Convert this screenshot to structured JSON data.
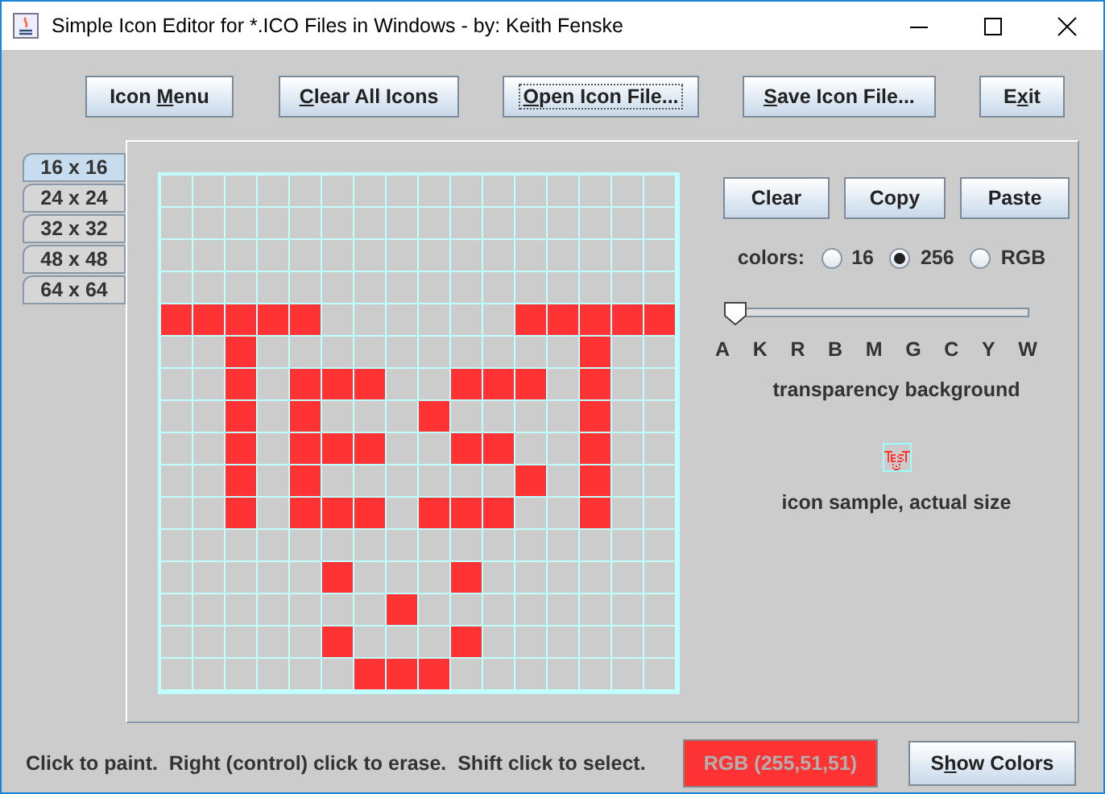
{
  "window": {
    "title": "Simple Icon Editor for *.ICO Files in Windows - by: Keith Fenske"
  },
  "toolbar": [
    {
      "before": "Icon ",
      "key": "M",
      "after": "enu",
      "focused": false
    },
    {
      "key": "C",
      "after": "lear All Icons",
      "focused": false
    },
    {
      "key": "O",
      "after": "pen Icon File...",
      "focused": true
    },
    {
      "key": "S",
      "after": "ave Icon File...",
      "focused": false
    },
    {
      "before": "E",
      "key": "x",
      "after": "it",
      "focused": false
    }
  ],
  "size_tabs": [
    {
      "label": "16 x 16",
      "selected": true
    },
    {
      "label": "24 x 24",
      "selected": false
    },
    {
      "label": "32 x 32",
      "selected": false
    },
    {
      "label": "48 x 48",
      "selected": false
    },
    {
      "label": "64 x 64",
      "selected": false
    }
  ],
  "canvas": {
    "rows": [
      [
        false,
        false,
        false,
        false,
        false,
        false,
        false,
        false,
        false,
        false,
        false,
        false,
        false,
        false,
        false,
        false
      ],
      [
        false,
        false,
        false,
        false,
        false,
        false,
        false,
        false,
        false,
        false,
        false,
        false,
        false,
        false,
        false,
        false
      ],
      [
        false,
        false,
        false,
        false,
        false,
        false,
        false,
        false,
        false,
        false,
        false,
        false,
        false,
        false,
        false,
        false
      ],
      [
        false,
        false,
        false,
        false,
        false,
        false,
        false,
        false,
        false,
        false,
        false,
        false,
        false,
        false,
        false,
        false
      ],
      [
        true,
        true,
        true,
        true,
        true,
        false,
        false,
        false,
        false,
        false,
        false,
        true,
        true,
        true,
        true,
        true
      ],
      [
        false,
        false,
        true,
        false,
        false,
        false,
        false,
        false,
        false,
        false,
        false,
        false,
        false,
        true,
        false,
        false
      ],
      [
        false,
        false,
        true,
        false,
        true,
        true,
        true,
        false,
        false,
        true,
        true,
        true,
        false,
        true,
        false,
        false
      ],
      [
        false,
        false,
        true,
        false,
        true,
        false,
        false,
        false,
        true,
        false,
        false,
        false,
        false,
        true,
        false,
        false
      ],
      [
        false,
        false,
        true,
        false,
        true,
        true,
        true,
        false,
        false,
        true,
        true,
        false,
        false,
        true,
        false,
        false
      ],
      [
        false,
        false,
        true,
        false,
        true,
        false,
        false,
        false,
        false,
        false,
        false,
        true,
        false,
        true,
        false,
        false
      ],
      [
        false,
        false,
        true,
        false,
        true,
        true,
        true,
        false,
        true,
        true,
        true,
        false,
        false,
        true,
        false,
        false
      ],
      [
        false,
        false,
        false,
        false,
        false,
        false,
        false,
        false,
        false,
        false,
        false,
        false,
        false,
        false,
        false,
        false
      ],
      [
        false,
        false,
        false,
        false,
        false,
        true,
        false,
        false,
        false,
        true,
        false,
        false,
        false,
        false,
        false,
        false
      ],
      [
        false,
        false,
        false,
        false,
        false,
        false,
        false,
        true,
        false,
        false,
        false,
        false,
        false,
        false,
        false,
        false
      ],
      [
        false,
        false,
        false,
        false,
        false,
        true,
        false,
        false,
        false,
        true,
        false,
        false,
        false,
        false,
        false,
        false
      ],
      [
        false,
        false,
        false,
        false,
        false,
        false,
        true,
        true,
        true,
        false,
        false,
        false,
        false,
        false,
        false,
        false
      ]
    ]
  },
  "edit_buttons": [
    "Clear",
    "Copy",
    "Paste"
  ],
  "colors": {
    "label": "colors:",
    "options": [
      {
        "label": "16",
        "selected": false
      },
      {
        "label": "256",
        "selected": true
      },
      {
        "label": "RGB",
        "selected": false
      }
    ]
  },
  "transparency": {
    "level": 0,
    "ticks": [
      "A",
      "K",
      "R",
      "B",
      "M",
      "G",
      "C",
      "Y",
      "W"
    ],
    "caption": "transparency background"
  },
  "sample_caption": "icon sample, actual size",
  "status": {
    "hint": "Click to paint.  Right (control) click to erase.  Shift click to select.",
    "color_readout": "RGB (255,51,51)",
    "show_colors": {
      "before": "S",
      "key": "h",
      "after": "ow Colors"
    }
  }
}
